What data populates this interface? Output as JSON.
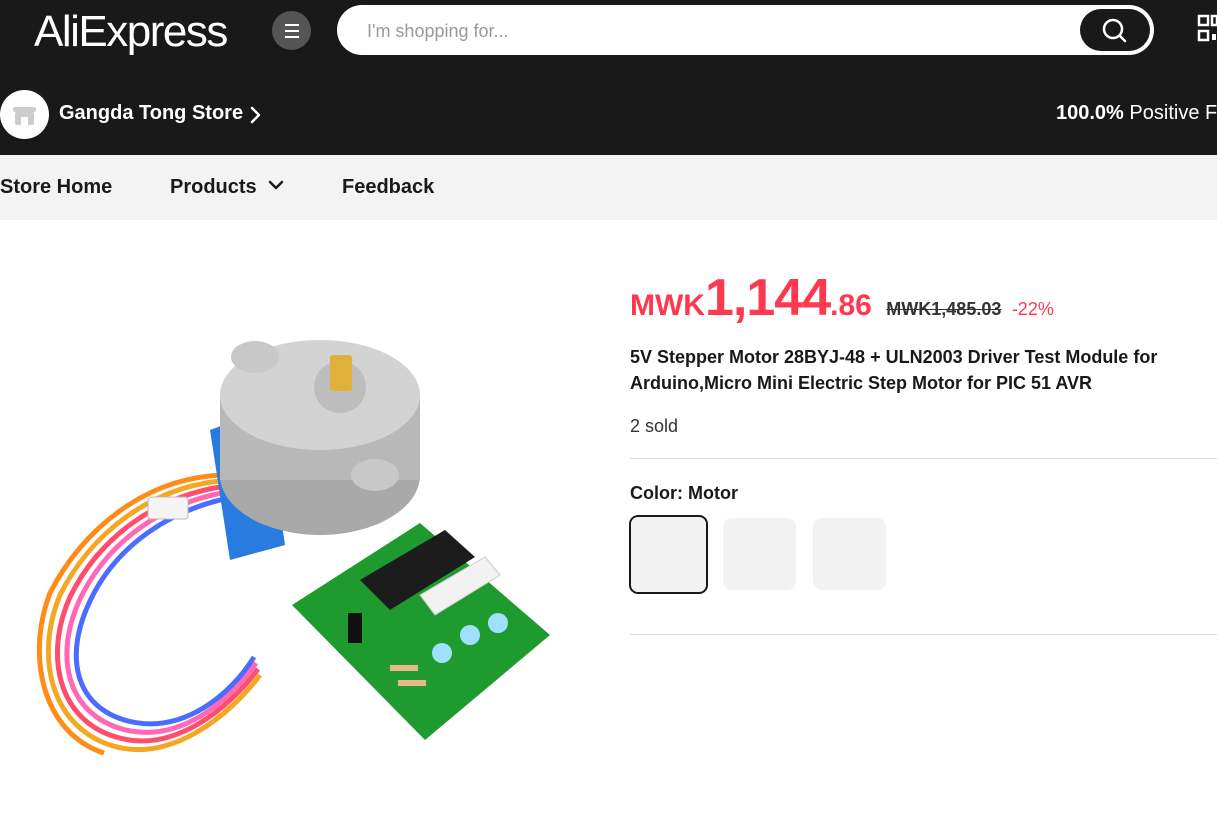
{
  "header": {
    "logo": "AliExpress",
    "menu_icon": "hamburger-icon",
    "search": {
      "placeholder": "I'm shopping for...",
      "value": "",
      "icon": "search-icon"
    },
    "qr_icon": "qr-code-icon"
  },
  "store": {
    "name": "Gangda Tong Store",
    "feedback_percent": "100.0%",
    "feedback_text": "Positive Fe"
  },
  "store_nav": {
    "items": [
      {
        "label": "Store Home"
      },
      {
        "label": "Products"
      },
      {
        "label": "Feedback"
      }
    ]
  },
  "product": {
    "price": {
      "currency": "MWK",
      "integer": "1,144",
      "decimal": ".86"
    },
    "original_price": "MWK1,485.03",
    "discount": "-22%",
    "title": "5V Stepper Motor 28BYJ-48 + ULN2003 Driver Test Module for Arduino,Micro Mini Electric Step Motor for PIC 51 AVR",
    "sold": "2 sold",
    "color_label": "Color: Motor",
    "color_options": [
      "Motor",
      "",
      ""
    ]
  },
  "colors": {
    "brand_red": "#fd384f",
    "header_bg": "#191919",
    "nav_bg": "#f3f3f3"
  }
}
